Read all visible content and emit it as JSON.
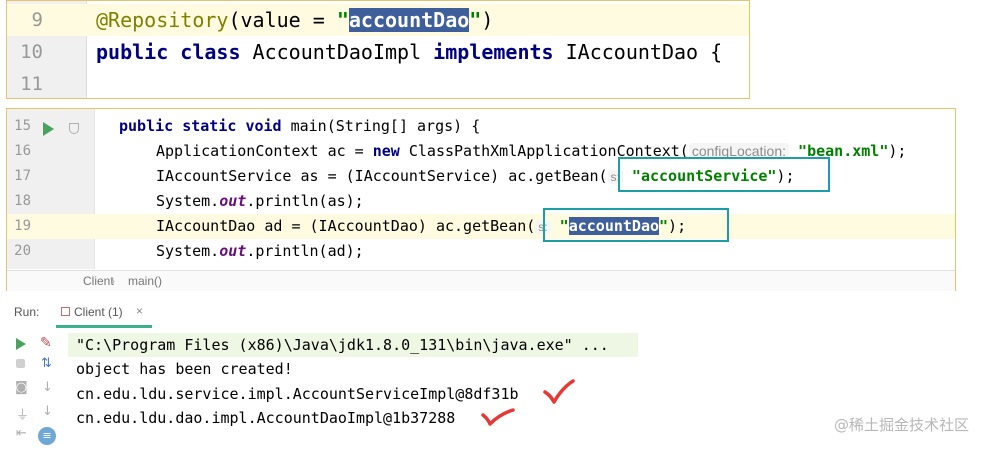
{
  "top_editor": {
    "lines": [
      {
        "number": "9",
        "annotation": "@Repository",
        "open": "(value = ",
        "string_open": "\"",
        "selected": "accountDao",
        "string_close": "\"",
        "close": ")"
      },
      {
        "number": "10",
        "kw1": "public",
        "kw2": "class",
        "name": " AccountDaoImpl ",
        "kw3": "implements",
        "rest": " IAccountDao {"
      },
      {
        "number": "11"
      }
    ]
  },
  "main_editor": {
    "lines": [
      {
        "number": "15",
        "kw1": "public",
        "kw2": "static",
        "kw3": "void",
        "rest": " main(String[] args) {"
      },
      {
        "number": "16",
        "pre": "ApplicationContext ac = ",
        "kw": "new",
        "mid": " ClassPathXmlApplicationContext(",
        "hint": "configLocation:",
        "str": "\"bean.xml\"",
        "post": ");"
      },
      {
        "number": "17",
        "pre": "IAccountService as = (IAccountService) ac.getBean(",
        "hint": "s:",
        "str": "\"accountService\"",
        "post": ");"
      },
      {
        "number": "18",
        "pre": "System.",
        "static": "out",
        "post": ".println(as);"
      },
      {
        "number": "19",
        "pre": "IAccountDao ad = (IAccountDao) ac.getBean(",
        "hint": "s:",
        "str_open": "\"",
        "selected": "accountDao",
        "str_close": "\"",
        "post": ");"
      },
      {
        "number": "20",
        "pre": "System.",
        "static": "out",
        "post": ".println(ad);"
      }
    ],
    "breadcrumb": {
      "class": "Client",
      "separator": "›",
      "method": "main()"
    }
  },
  "run_panel": {
    "label": "Run:",
    "tab": {
      "label": "Client (1)",
      "close": "×"
    },
    "console": [
      "\"C:\\Program Files (x86)\\Java\\jdk1.8.0_131\\bin\\java.exe\" ...",
      "object has been created!",
      "cn.edu.ldu.service.impl.AccountServiceImpl@8df31b",
      "cn.edu.ldu.dao.impl.AccountDaoImpl@1b37288"
    ],
    "toolbar_icons": [
      "rerun-icon",
      "wrench-icon",
      "stop-icon",
      "sort-icon",
      "camera-icon",
      "down-arrow-icon",
      "pin-icon",
      "down-arrow-icon",
      "exit-icon",
      "scroll-icon"
    ],
    "toolbar_glyphs": {
      "sort": "⇅",
      "camera": "◙",
      "down": "↓",
      "pin": "⏚",
      "exit": "⇤",
      "scroll": "≡",
      "wrench": "✎"
    }
  },
  "colors": {
    "callout": "#1d9ea7",
    "check": "#e53935",
    "selection": "#3f5f9c"
  },
  "watermark": "@稀土掘金技术社区"
}
